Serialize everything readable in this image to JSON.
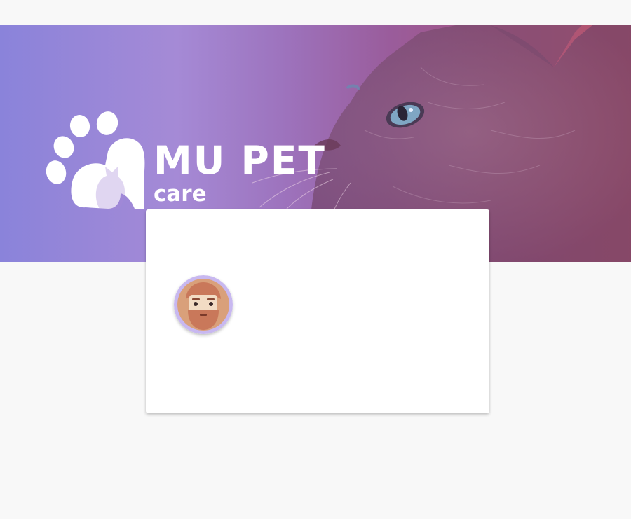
{
  "brand": {
    "name": "MU PET",
    "tagline": "care",
    "logo_icon": "paw-pet-icon"
  },
  "hero": {
    "image": "cat-photo",
    "gradient": [
      "#8a83da",
      "#a58ad6",
      "#9a5c9b",
      "#b8556a"
    ]
  },
  "profile": {
    "avatar_icon": "bearded-man-avatar-icon",
    "avatar_ring_color": "#c8b8f0"
  },
  "colors": {
    "background": "#f8f8f8",
    "card": "#ffffff"
  }
}
